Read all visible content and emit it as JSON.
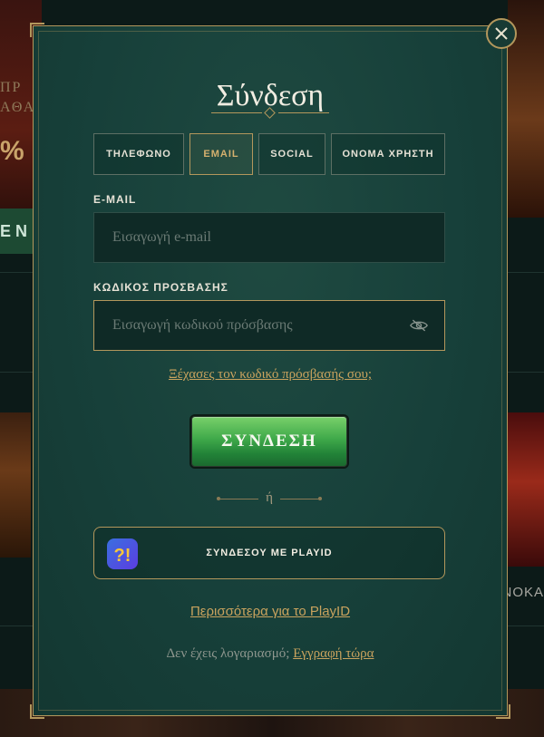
{
  "modal": {
    "title": "Σύνδεση",
    "close_icon": "close-icon",
    "tabs": [
      {
        "label": "ΤΗΛΕΦΩΝΟ",
        "active": false
      },
      {
        "label": "EMAIL",
        "active": true
      },
      {
        "label": "SOCIAL",
        "active": false
      },
      {
        "label": "ΟΝΟΜΑ ΧΡΗΣΤΗ",
        "active": false
      }
    ],
    "email": {
      "label": "E-MAIL",
      "placeholder": "Εισαγωγή e-mail",
      "value": ""
    },
    "password": {
      "label": "ΚΩΔΙΚΟΣ ΠΡΟΣΒΑΣΗΣ",
      "placeholder": "Εισαγωγή κωδικού πρόσβασης",
      "value": "",
      "toggle_icon": "eye-off-icon"
    },
    "forgot_link": "Ξέχασες τον κωδικό πρόσβασής σου;",
    "submit_label": "ΣΥΝΔΕΣΗ",
    "divider_text": "ή",
    "playid": {
      "label": "ΣΥΝΔΕΣΟΥ ΜΕ PLAYID",
      "logo_icon": "playid-logo-icon",
      "logo_glyph": "?!"
    },
    "more_link": "Περισσότερα για το PlayID",
    "no_account_text": "Δεν έχεις λογαριασμό;",
    "signup_link": "Εγγραφή τώρα"
  },
  "background": {
    "left_text_1": "ΠΡ",
    "left_text_2": "ΑΘΑ",
    "left_pct": "%",
    "left_button": "Ε Ν",
    "right_label": "ΝΟΚΑ"
  },
  "colors": {
    "accent_gold": "#b3975c",
    "link_gold": "#c9a35e",
    "modal_bg": "#17403a",
    "submit_green": "#3fa94a"
  }
}
